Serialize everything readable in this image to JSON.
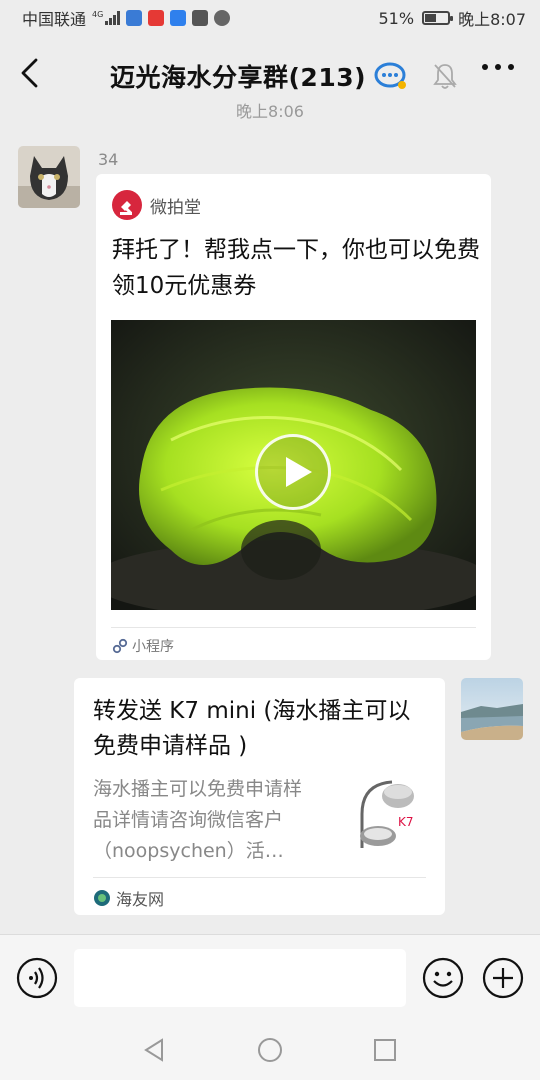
{
  "status_bar": {
    "carrier": "中国联通",
    "net_type": "4G",
    "battery": "51%",
    "time": "晚上8:07",
    "battery_level": 0.51
  },
  "header": {
    "title": "迈光海水分享群(213)",
    "peek_time": "晚上8:06"
  },
  "messages": [
    {
      "sender": "34",
      "card": {
        "type": "mini-program",
        "source": "微拍堂",
        "title": "拜托了！帮我点一下，你也可以免费领10元优惠券",
        "footer": "小程序"
      }
    },
    {
      "sender": "",
      "card": {
        "type": "link",
        "title": "转发送 K7 mini (海水播主可以免费申请样品 )",
        "desc": "海水播主可以免费申请样品详情请咨询微信客户（noopsychen）活…",
        "thumb_label": "K7",
        "source": "海友网"
      }
    }
  ],
  "input_bar": {
    "placeholder": ""
  },
  "colors": {
    "background": "#ededed",
    "card": "#ffffff",
    "brand_red": "#d7263d",
    "link_icon": "#576b95"
  },
  "icons": [
    "back-arrow-icon",
    "group-chat-icon",
    "mute-bell-icon",
    "more-icon",
    "voice-icon",
    "emoji-icon",
    "plus-icon",
    "nav-back-icon",
    "nav-home-icon",
    "nav-recent-icon"
  ]
}
